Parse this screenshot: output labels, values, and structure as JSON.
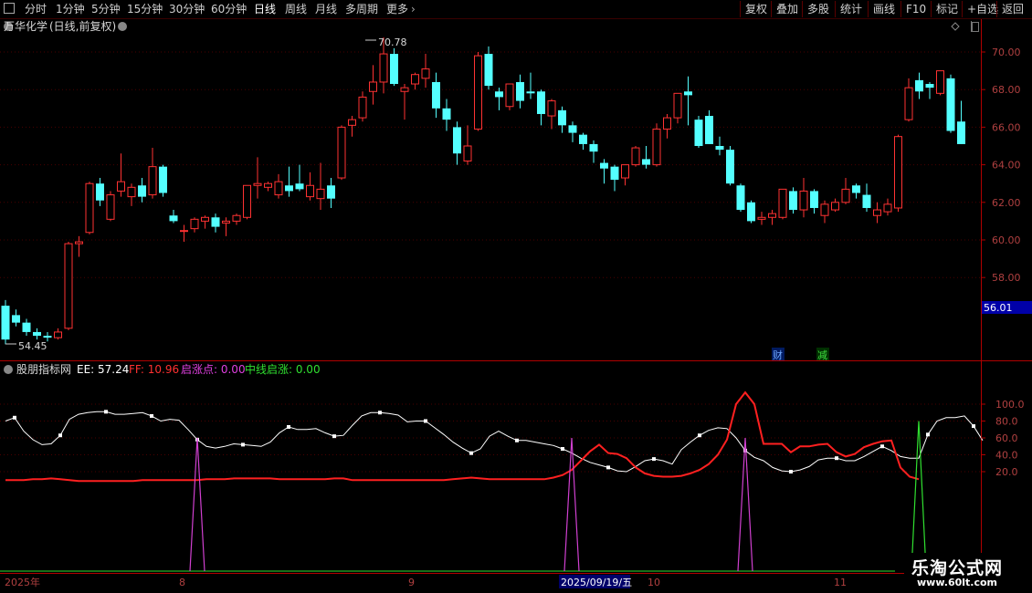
{
  "toolbar": {
    "menu_icon": "menu-square-icon",
    "periods": [
      "分时",
      "1分钟",
      "5分钟",
      "15分钟",
      "30分钟",
      "60分钟",
      "日线",
      "周线",
      "月线",
      "多周期",
      "更多"
    ],
    "active_period": "日线",
    "right_buttons": [
      "复权",
      "叠加",
      "多股",
      "统计",
      "画线",
      "F10",
      "标记",
      "+自选",
      "返回"
    ]
  },
  "stock": {
    "name": "万华化学",
    "mode": "(日线,前复权)",
    "high_label": "70.78",
    "low_label": "54.45",
    "current_price": "56.01",
    "badge_cai": "财",
    "badge_jian": "减"
  },
  "indicator": {
    "name": "股朋指标网",
    "ee_label": "EE: 57.24",
    "ff_label": "FF: 10.96",
    "qzd_label": "启涨点: 0.00",
    "zxqz_label": "中线启涨: 0.00"
  },
  "x_axis": {
    "labels": [
      "2025年",
      "8",
      "9",
      "2025/09/19/五",
      "10",
      "11"
    ]
  },
  "watermark": {
    "line1": "乐淘公式网",
    "line2": "www.60lt.com"
  },
  "colors": {
    "up": "#ff3232",
    "down": "#54ffff",
    "axis": "#b00000",
    "ee": "#ffffff",
    "ff": "#ff2020",
    "qzd": "#d040d0",
    "zxqz": "#30e030"
  },
  "chart_data": [
    {
      "type": "candlestick",
      "title": "万华化学 (日线,前复权)",
      "y_ticks": [
        58,
        60,
        62,
        64,
        66,
        68,
        70
      ],
      "ylim": [
        53.5,
        71.5
      ],
      "high_marker": 70.78,
      "low_marker": 54.45,
      "last_price": 56.01,
      "ohlc": [
        [
          56.5,
          56.8,
          54.45,
          54.7
        ],
        [
          56.0,
          56.3,
          55.4,
          55.6
        ],
        [
          55.6,
          55.8,
          54.9,
          55.1
        ],
        [
          55.1,
          55.3,
          54.7,
          54.9
        ],
        [
          54.9,
          55.1,
          54.6,
          54.8
        ],
        [
          54.8,
          55.3,
          54.7,
          55.1
        ],
        [
          55.3,
          59.9,
          55.2,
          59.8
        ],
        [
          59.8,
          60.2,
          59.1,
          59.9
        ],
        [
          60.4,
          63.1,
          60.3,
          63.0
        ],
        [
          63.0,
          63.3,
          61.8,
          62.1
        ],
        [
          61.1,
          62.6,
          61.0,
          62.4
        ],
        [
          62.6,
          64.6,
          62.3,
          63.1
        ],
        [
          62.3,
          63.0,
          61.8,
          62.8
        ],
        [
          62.9,
          63.3,
          62.0,
          62.3
        ],
        [
          62.4,
          64.9,
          62.2,
          63.9
        ],
        [
          63.9,
          64.0,
          62.3,
          62.5
        ],
        [
          61.3,
          61.6,
          60.9,
          61.0
        ],
        [
          60.5,
          60.8,
          59.9,
          60.5
        ],
        [
          60.6,
          61.2,
          60.4,
          61.1
        ],
        [
          61.0,
          61.3,
          60.6,
          61.2
        ],
        [
          61.2,
          61.4,
          60.4,
          60.7
        ],
        [
          60.9,
          61.2,
          60.2,
          61.0
        ],
        [
          61.0,
          61.4,
          60.8,
          61.3
        ],
        [
          61.2,
          62.9,
          61.1,
          62.9
        ],
        [
          62.9,
          64.4,
          62.2,
          63.0
        ],
        [
          62.8,
          63.1,
          62.6,
          63.0
        ],
        [
          62.4,
          63.5,
          62.2,
          63.1
        ],
        [
          62.9,
          63.9,
          62.3,
          62.6
        ],
        [
          63.0,
          64.0,
          62.6,
          62.7
        ],
        [
          62.3,
          63.6,
          62.1,
          62.9
        ],
        [
          62.2,
          64.1,
          61.6,
          62.7
        ],
        [
          62.9,
          63.3,
          61.7,
          62.2
        ],
        [
          63.3,
          66.1,
          63.2,
          66.0
        ],
        [
          66.1,
          66.6,
          65.5,
          66.4
        ],
        [
          66.5,
          67.9,
          66.3,
          67.6
        ],
        [
          67.9,
          69.3,
          67.2,
          68.4
        ],
        [
          68.4,
          70.78,
          67.8,
          69.9
        ],
        [
          69.9,
          70.2,
          68.2,
          68.3
        ],
        [
          67.9,
          68.3,
          66.4,
          68.1
        ],
        [
          68.3,
          68.9,
          68.0,
          68.8
        ],
        [
          68.6,
          69.9,
          68.1,
          69.1
        ],
        [
          68.4,
          68.9,
          66.5,
          67.0
        ],
        [
          67.0,
          67.5,
          65.8,
          66.4
        ],
        [
          66.0,
          66.3,
          64.0,
          64.6
        ],
        [
          64.2,
          66.1,
          64.0,
          65.0
        ],
        [
          65.9,
          70.0,
          65.8,
          69.8
        ],
        [
          69.9,
          70.3,
          68.0,
          68.2
        ],
        [
          67.9,
          68.1,
          66.9,
          67.6
        ],
        [
          67.1,
          68.2,
          66.9,
          68.3
        ],
        [
          68.4,
          68.8,
          67.0,
          67.4
        ],
        [
          67.9,
          68.9,
          67.5,
          67.8
        ],
        [
          67.9,
          68.0,
          66.1,
          66.7
        ],
        [
          66.6,
          67.5,
          65.9,
          67.4
        ],
        [
          66.9,
          67.1,
          65.7,
          66.1
        ],
        [
          66.1,
          66.3,
          65.2,
          65.7
        ],
        [
          65.6,
          65.7,
          64.8,
          65.1
        ],
        [
          65.1,
          65.3,
          64.1,
          64.7
        ],
        [
          64.1,
          64.3,
          63.0,
          63.8
        ],
        [
          63.9,
          64.0,
          62.6,
          63.2
        ],
        [
          63.3,
          64.0,
          62.9,
          64.0
        ],
        [
          64.0,
          65.0,
          63.9,
          64.9
        ],
        [
          64.3,
          65.0,
          63.8,
          64.0
        ],
        [
          64.0,
          66.2,
          63.9,
          65.9
        ],
        [
          65.9,
          66.7,
          65.4,
          66.5
        ],
        [
          66.5,
          67.8,
          66.2,
          67.8
        ],
        [
          67.9,
          68.7,
          66.1,
          67.7
        ],
        [
          66.4,
          66.6,
          64.9,
          65.0
        ],
        [
          66.6,
          66.9,
          65.1,
          65.1
        ],
        [
          65.0,
          65.5,
          64.5,
          64.8
        ],
        [
          64.8,
          65.0,
          62.9,
          63.0
        ],
        [
          62.9,
          63.0,
          61.5,
          61.6
        ],
        [
          62.0,
          62.1,
          60.9,
          61.0
        ],
        [
          61.1,
          61.5,
          60.8,
          61.2
        ],
        [
          61.2,
          61.6,
          60.8,
          61.4
        ],
        [
          61.2,
          62.7,
          61.1,
          62.7
        ],
        [
          62.6,
          62.8,
          61.4,
          61.6
        ],
        [
          61.6,
          63.3,
          61.2,
          62.6
        ],
        [
          62.6,
          62.7,
          61.4,
          61.7
        ],
        [
          61.3,
          62.1,
          60.9,
          61.9
        ],
        [
          61.6,
          62.2,
          61.5,
          62.0
        ],
        [
          62.0,
          63.3,
          61.9,
          62.7
        ],
        [
          62.9,
          63.0,
          62.2,
          62.5
        ],
        [
          62.4,
          63.0,
          61.5,
          61.7
        ],
        [
          61.3,
          62.0,
          60.9,
          61.6
        ],
        [
          61.5,
          62.2,
          61.3,
          61.9
        ],
        [
          61.7,
          65.6,
          61.5,
          65.5
        ],
        [
          66.4,
          68.6,
          66.3,
          68.1
        ],
        [
          68.5,
          68.9,
          67.5,
          67.9
        ],
        [
          68.3,
          68.4,
          67.5,
          68.1
        ],
        [
          67.8,
          69.0,
          67.7,
          69.0
        ],
        [
          68.6,
          68.8,
          65.7,
          65.8
        ],
        [
          66.3,
          67.4,
          65.1,
          65.1
        ]
      ]
    },
    {
      "type": "line",
      "title": "股朋指标网",
      "y_ticks": [
        20,
        40,
        60,
        80,
        100
      ],
      "ylim": [
        5,
        120
      ],
      "series": [
        {
          "name": "EE",
          "values": [
            80,
            84,
            68,
            58,
            52,
            53,
            63,
            82,
            88,
            90,
            91,
            91,
            88,
            88,
            89,
            90,
            86,
            80,
            82,
            81,
            70,
            58,
            50,
            48,
            50,
            53,
            52,
            51,
            50,
            55,
            66,
            73,
            70,
            70,
            71,
            66,
            62,
            63,
            75,
            86,
            90,
            90,
            89,
            87,
            79,
            80,
            80,
            72,
            64,
            55,
            48,
            42,
            47,
            62,
            68,
            62,
            57,
            57,
            55,
            53,
            51,
            47,
            42,
            36,
            31,
            28,
            25,
            21,
            20,
            26,
            33,
            35,
            33,
            29,
            46,
            55,
            63,
            69,
            72,
            71,
            60,
            45,
            37,
            33,
            25,
            21,
            20,
            22,
            26,
            34,
            36,
            36,
            33,
            33,
            38,
            44,
            50,
            45,
            38,
            36,
            36,
            64,
            80,
            84,
            84,
            86,
            74,
            57
          ]
        },
        {
          "name": "FF",
          "values": [
            10,
            10,
            10,
            11,
            11,
            12,
            11,
            10,
            9,
            9,
            9,
            9,
            9,
            9,
            9,
            10,
            10,
            10,
            10,
            10,
            10,
            10,
            11,
            11,
            11,
            12,
            12,
            12,
            12,
            12,
            11,
            11,
            11,
            11,
            11,
            11,
            12,
            12,
            10,
            10,
            10,
            10,
            10,
            10,
            10,
            10,
            10,
            10,
            10,
            11,
            12,
            13,
            12,
            11,
            11,
            11,
            11,
            11,
            11,
            11,
            13,
            16,
            22,
            33,
            44,
            52,
            42,
            41,
            36,
            25,
            18,
            15,
            14,
            14,
            15,
            18,
            22,
            29,
            40,
            58,
            100,
            114,
            100,
            53,
            53,
            53,
            43,
            50,
            50,
            52,
            53,
            43,
            38,
            41,
            49,
            53,
            56,
            57,
            25,
            14,
            11
          ]
        },
        {
          "name": "启涨点",
          "spikes": [
            {
              "i": 21,
              "v": 60
            },
            {
              "i": 62,
              "v": 60
            },
            {
              "i": 81,
              "v": 60
            }
          ]
        },
        {
          "name": "中线启涨",
          "spikes": [
            {
              "i": 100,
              "v": 80
            }
          ]
        }
      ]
    }
  ]
}
